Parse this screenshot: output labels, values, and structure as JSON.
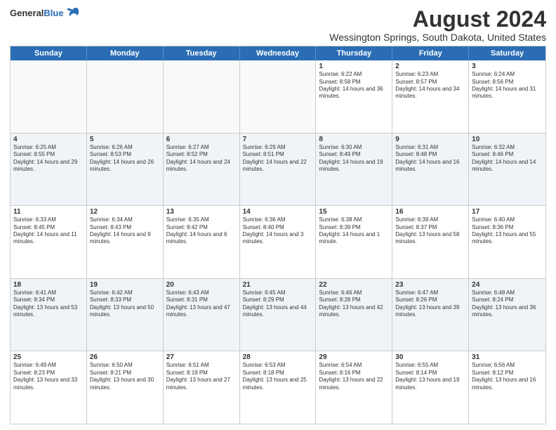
{
  "logo": {
    "general": "General",
    "blue": "Blue"
  },
  "title": "August 2024",
  "subtitle": "Wessington Springs, South Dakota, United States",
  "days": [
    "Sunday",
    "Monday",
    "Tuesday",
    "Wednesday",
    "Thursday",
    "Friday",
    "Saturday"
  ],
  "rows": [
    [
      {
        "date": "",
        "content": ""
      },
      {
        "date": "",
        "content": ""
      },
      {
        "date": "",
        "content": ""
      },
      {
        "date": "",
        "content": ""
      },
      {
        "date": "1",
        "content": "Sunrise: 6:22 AM\nSunset: 8:58 PM\nDaylight: 14 hours and 36 minutes."
      },
      {
        "date": "2",
        "content": "Sunrise: 6:23 AM\nSunset: 8:57 PM\nDaylight: 14 hours and 34 minutes."
      },
      {
        "date": "3",
        "content": "Sunrise: 6:24 AM\nSunset: 8:56 PM\nDaylight: 14 hours and 31 minutes."
      }
    ],
    [
      {
        "date": "4",
        "content": "Sunrise: 6:25 AM\nSunset: 8:55 PM\nDaylight: 14 hours and 29 minutes."
      },
      {
        "date": "5",
        "content": "Sunrise: 6:26 AM\nSunset: 8:53 PM\nDaylight: 14 hours and 26 minutes."
      },
      {
        "date": "6",
        "content": "Sunrise: 6:27 AM\nSunset: 8:52 PM\nDaylight: 14 hours and 24 minutes."
      },
      {
        "date": "7",
        "content": "Sunrise: 6:29 AM\nSunset: 8:51 PM\nDaylight: 14 hours and 22 minutes."
      },
      {
        "date": "8",
        "content": "Sunrise: 6:30 AM\nSunset: 8:49 PM\nDaylight: 14 hours and 19 minutes."
      },
      {
        "date": "9",
        "content": "Sunrise: 6:31 AM\nSunset: 8:48 PM\nDaylight: 14 hours and 16 minutes."
      },
      {
        "date": "10",
        "content": "Sunrise: 6:32 AM\nSunset: 8:46 PM\nDaylight: 14 hours and 14 minutes."
      }
    ],
    [
      {
        "date": "11",
        "content": "Sunrise: 6:33 AM\nSunset: 8:45 PM\nDaylight: 14 hours and 11 minutes."
      },
      {
        "date": "12",
        "content": "Sunrise: 6:34 AM\nSunset: 8:43 PM\nDaylight: 14 hours and 9 minutes."
      },
      {
        "date": "13",
        "content": "Sunrise: 6:35 AM\nSunset: 8:42 PM\nDaylight: 14 hours and 6 minutes."
      },
      {
        "date": "14",
        "content": "Sunrise: 6:36 AM\nSunset: 8:40 PM\nDaylight: 14 hours and 3 minutes."
      },
      {
        "date": "15",
        "content": "Sunrise: 6:38 AM\nSunset: 8:39 PM\nDaylight: 14 hours and 1 minute."
      },
      {
        "date": "16",
        "content": "Sunrise: 6:39 AM\nSunset: 8:37 PM\nDaylight: 13 hours and 58 minutes."
      },
      {
        "date": "17",
        "content": "Sunrise: 6:40 AM\nSunset: 8:36 PM\nDaylight: 13 hours and 55 minutes."
      }
    ],
    [
      {
        "date": "18",
        "content": "Sunrise: 6:41 AM\nSunset: 8:34 PM\nDaylight: 13 hours and 53 minutes."
      },
      {
        "date": "19",
        "content": "Sunrise: 6:42 AM\nSunset: 8:33 PM\nDaylight: 13 hours and 50 minutes."
      },
      {
        "date": "20",
        "content": "Sunrise: 6:43 AM\nSunset: 8:31 PM\nDaylight: 13 hours and 47 minutes."
      },
      {
        "date": "21",
        "content": "Sunrise: 6:45 AM\nSunset: 8:29 PM\nDaylight: 13 hours and 44 minutes."
      },
      {
        "date": "22",
        "content": "Sunrise: 6:46 AM\nSunset: 8:28 PM\nDaylight: 13 hours and 42 minutes."
      },
      {
        "date": "23",
        "content": "Sunrise: 6:47 AM\nSunset: 8:26 PM\nDaylight: 13 hours and 39 minutes."
      },
      {
        "date": "24",
        "content": "Sunrise: 6:48 AM\nSunset: 8:24 PM\nDaylight: 13 hours and 36 minutes."
      }
    ],
    [
      {
        "date": "25",
        "content": "Sunrise: 6:49 AM\nSunset: 8:23 PM\nDaylight: 13 hours and 33 minutes."
      },
      {
        "date": "26",
        "content": "Sunrise: 6:50 AM\nSunset: 8:21 PM\nDaylight: 13 hours and 30 minutes."
      },
      {
        "date": "27",
        "content": "Sunrise: 6:51 AM\nSunset: 8:19 PM\nDaylight: 13 hours and 27 minutes."
      },
      {
        "date": "28",
        "content": "Sunrise: 6:53 AM\nSunset: 8:18 PM\nDaylight: 13 hours and 25 minutes."
      },
      {
        "date": "29",
        "content": "Sunrise: 6:54 AM\nSunset: 8:16 PM\nDaylight: 13 hours and 22 minutes."
      },
      {
        "date": "30",
        "content": "Sunrise: 6:55 AM\nSunset: 8:14 PM\nDaylight: 13 hours and 19 minutes."
      },
      {
        "date": "31",
        "content": "Sunrise: 6:56 AM\nSunset: 8:12 PM\nDaylight: 13 hours and 16 minutes."
      }
    ]
  ]
}
